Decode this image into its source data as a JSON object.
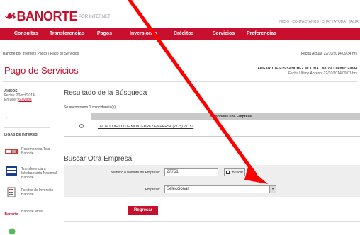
{
  "header": {
    "logo": "BANORTE",
    "logo_sub": "POR INTERNET",
    "top_links": "INICIO | CONTACTANOS | CHAT | AYUDA | SALIR"
  },
  "nav": [
    {
      "label": "Consultas"
    },
    {
      "label": "Transferencias"
    },
    {
      "label": "Pagos"
    },
    {
      "label": "Inversiones"
    },
    {
      "label": "Créditos"
    },
    {
      "label": "Servicios"
    },
    {
      "label": "Preferencias"
    }
  ],
  "breadcrumb": "Banorte por Internet | Pagos | Pago de Servicios",
  "fecha_actual": "Fecha Actual: 22/10/2014 09:34 hrs",
  "page_title": "Pago de Servicios",
  "user": {
    "name_line": "EDGARD JESUS SANCHEZ MOLINA | No. de Cliente: 22884",
    "last_access": "Fecha Último Acceso: 22/10/2014 09:01 hrs"
  },
  "sidebar": {
    "aviso_title": "AVISOS",
    "aviso_fecha": "Fecha: 20/oct/2014",
    "aviso_leer_prefix": "En Leer: ",
    "aviso_leer_link": "6 avisos",
    "dot": "•",
    "links_title": "LIGAS DE INTERES",
    "links": [
      {
        "label": "Recompensa Total Banorte"
      },
      {
        "label": "Transferencia a Interbancaria Nacional Banorte"
      },
      {
        "label": "Fondos de Inversión Banorte"
      },
      {
        "label": "Banorte Móvil"
      }
    ]
  },
  "results": {
    "title": "Resultado de la Búsqueda",
    "count": "Se encontraron 1 coincidencia(s)",
    "table_header": "Seleccione una Empresa",
    "row": "TECNOLOGICO DE MONTERREY EMPRESA (2775) 27751"
  },
  "search_form": {
    "title": "Buscar Otra Empresa",
    "label_num": "Número o nombre de Empresa:",
    "input_value": "27751",
    "buscar": "Buscar",
    "label_empresa": "Empresa:",
    "select_value": "Seleccionar",
    "select_arrow": "▾"
  },
  "regresar": "Regresar",
  "colors": {
    "brand_red": "#c8102e",
    "annotation_arrow": "#ff0000"
  }
}
